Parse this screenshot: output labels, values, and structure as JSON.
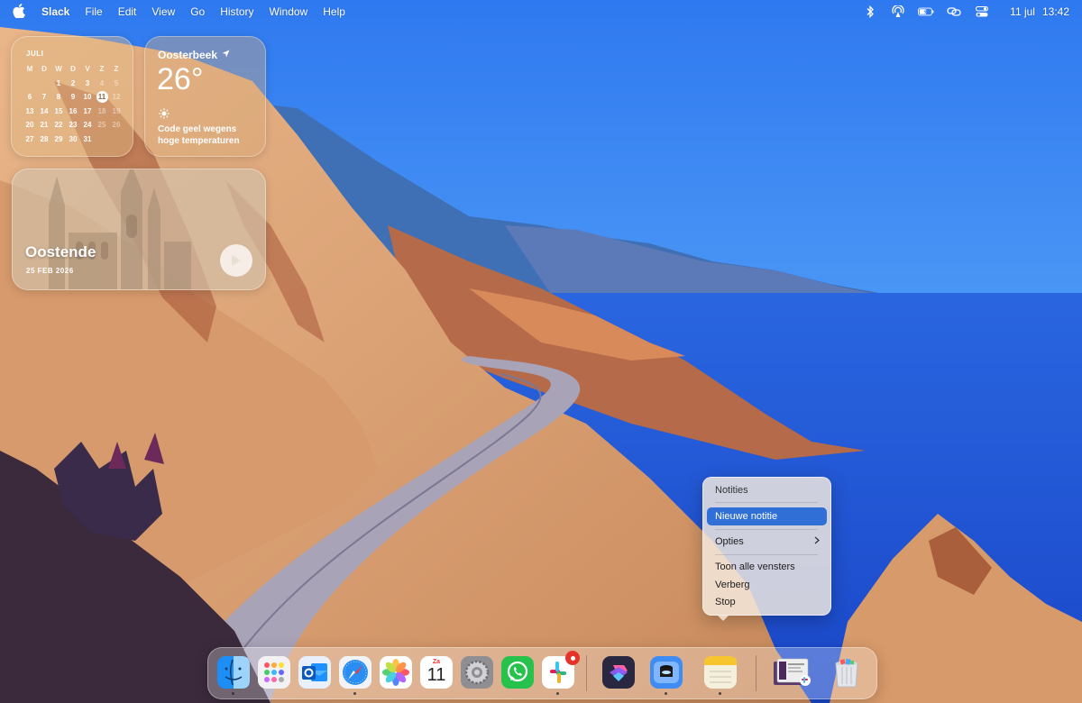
{
  "menubar": {
    "apple_icon": "apple-logo-icon",
    "app_name": "Slack",
    "menus": [
      "File",
      "Edit",
      "View",
      "Go",
      "History",
      "Window",
      "Help"
    ],
    "status_icons": [
      "bluetooth-icon",
      "airdrop-icon",
      "battery-icon",
      "screen-mirroring-icon",
      "control-center-icon"
    ],
    "date": "11 jul",
    "time": "13:42"
  },
  "calendar_widget": {
    "month": "JULI",
    "weekdays": [
      "M",
      "D",
      "W",
      "D",
      "V",
      "Z",
      "Z"
    ],
    "weeks": [
      [
        "",
        "",
        "1",
        "2",
        "3",
        "4",
        "5"
      ],
      [
        "6",
        "7",
        "8",
        "9",
        "10",
        "11",
        "12"
      ],
      [
        "13",
        "14",
        "15",
        "16",
        "17",
        "18",
        "19"
      ],
      [
        "20",
        "21",
        "22",
        "23",
        "24",
        "25",
        "26"
      ],
      [
        "27",
        "28",
        "29",
        "30",
        "31",
        "",
        ""
      ]
    ],
    "today": "11"
  },
  "weather_widget": {
    "city": "Oosterbeek",
    "location_icon": "location-arrow-icon",
    "temperature": "26°",
    "condition_icon": "sun-icon",
    "description": "Code geel wegens hoge temperaturen"
  },
  "photos_widget": {
    "place": "Oostende",
    "date": "25 FEB 2026",
    "play_icon": "play-icon"
  },
  "context_menu": {
    "title": "Notities",
    "items": {
      "new_note": "Nieuwe notitie",
      "options": "Opties",
      "show_all_windows": "Toon alle vensters",
      "hide": "Verberg",
      "quit": "Stop"
    },
    "highlighted": "Nieuwe notitie"
  },
  "dock": {
    "apps": [
      "Finder",
      "Launchpad",
      "Outlook",
      "Safari",
      "Photos",
      "Calendar",
      "System Settings",
      "WhatsApp",
      "Slack",
      "Shortcuts",
      "Preview",
      "Notes",
      "Downloads",
      "Trash"
    ],
    "calendar_icon": {
      "day": "Za",
      "date": "11"
    },
    "slack_badge": "notification-badge"
  },
  "colors": {
    "highlight": "#2f6fd6",
    "sky": "#3a86f2",
    "sea": "#1d56d8"
  }
}
